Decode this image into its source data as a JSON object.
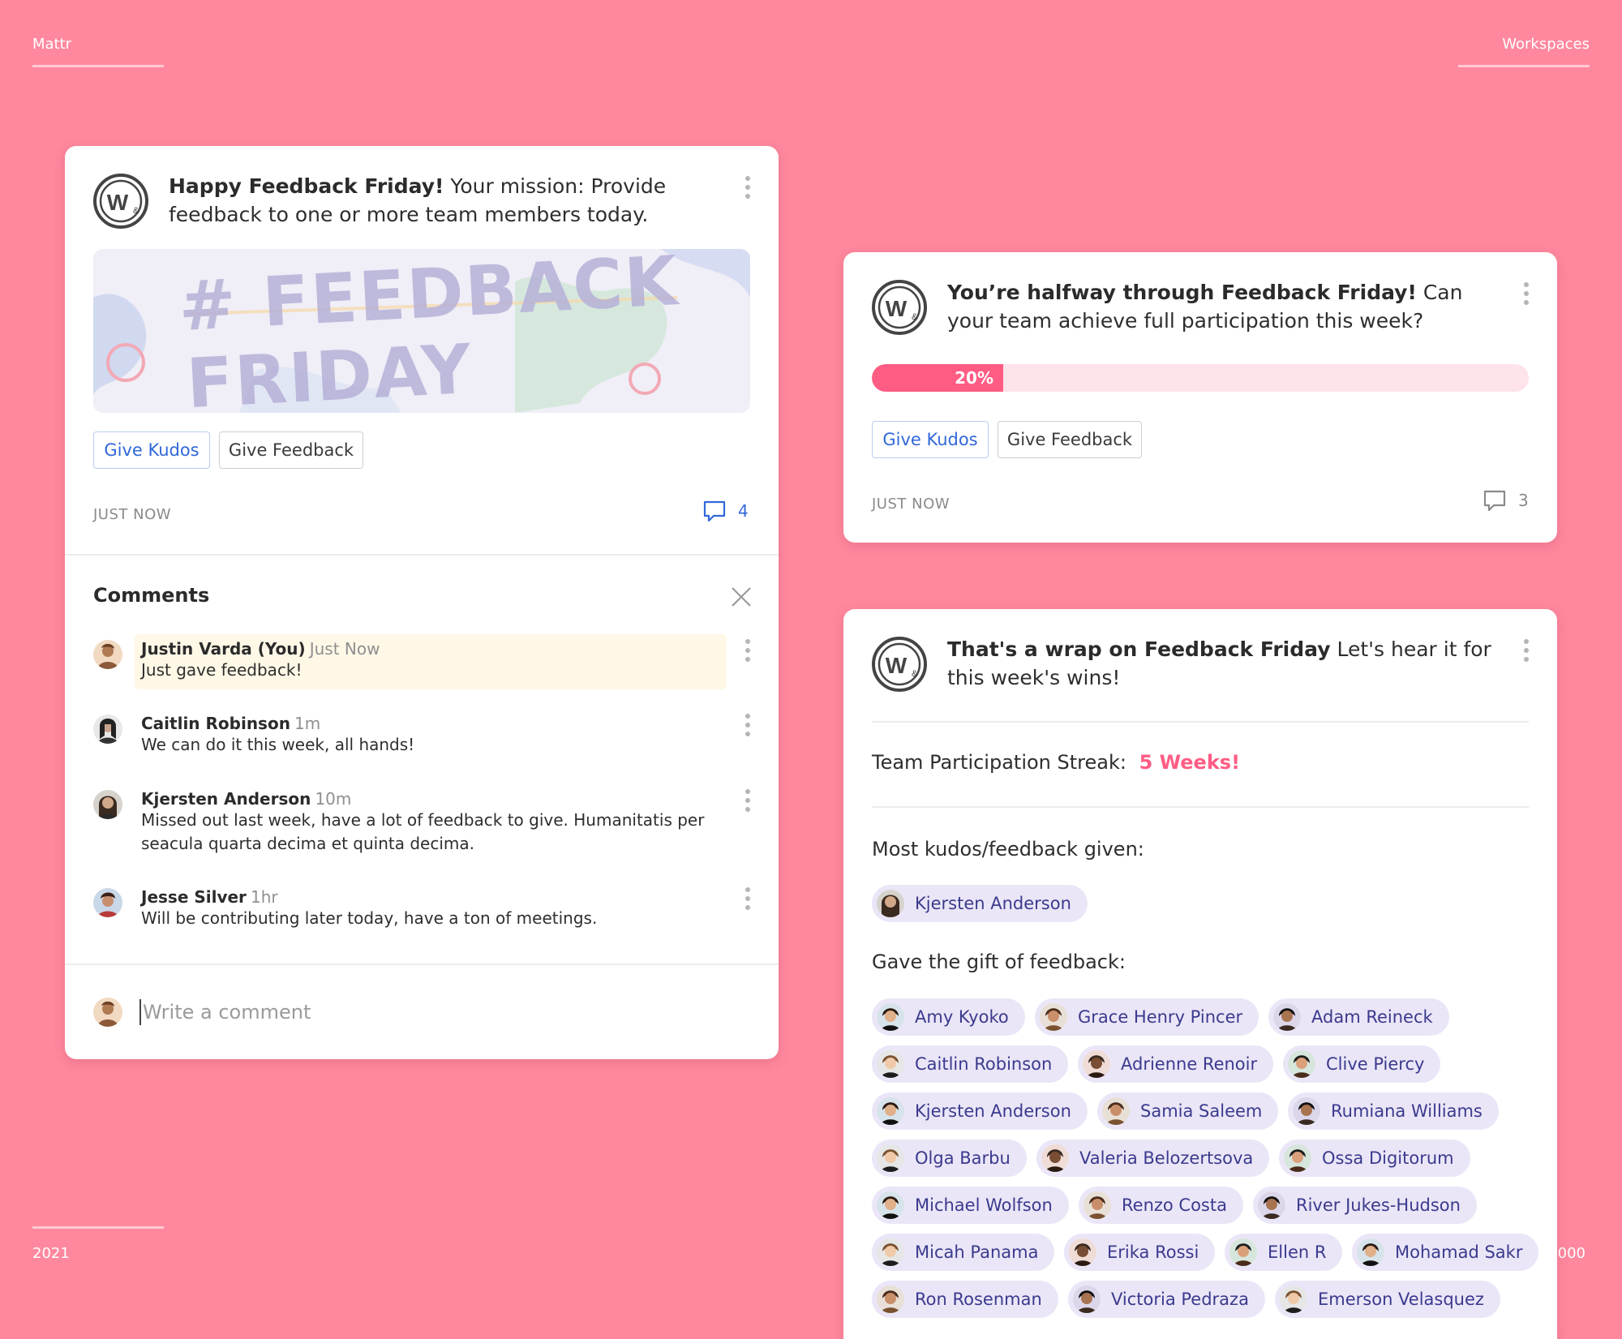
{
  "corners": {
    "top_left": "Mattr",
    "top_right": "Workspaces",
    "bottom_left": "2021",
    "bottom_right": "000"
  },
  "colors": {
    "background": "#FF889E",
    "accent_pink": "#FF5C84",
    "link_blue": "#3168d9",
    "pill_bg": "#EAE6F7",
    "pill_text": "#3b3a8e",
    "highlight": "#FFF8E7"
  },
  "card1": {
    "headline_bold": "Happy Feedback Friday!",
    "headline_rest": " Your mission: Provide feedback to one or more team members today.",
    "banner_line1": "# FEEDBACK",
    "banner_line2": "FRIDAY",
    "kudos_label": "Give Kudos",
    "feedback_label": "Give Feedback",
    "timestamp": "JUST NOW",
    "comment_count": "4",
    "comments_title": "Comments",
    "comments": [
      {
        "name": "Justin Varda (You)",
        "time": "Just Now",
        "text": "Just gave feedback!"
      },
      {
        "name": "Caitlin Robinson",
        "time": "1m",
        "text": "We can do it this week, all hands!"
      },
      {
        "name": "Kjersten Anderson",
        "time": "10m",
        "text": "Missed out last week, have a lot of feedback to give. Humanitatis per seacula quarta decima et quinta decima."
      },
      {
        "name": "Jesse Silver",
        "time": "1hr",
        "text": "Will be contributing later today, have a ton of meetings."
      }
    ],
    "comment_placeholder": "Write a comment"
  },
  "card2": {
    "headline_bold": "You’re halfway through Feedback Friday!",
    "headline_rest": " Can your team achieve full participation this week?",
    "progress_label": "20%",
    "progress_value": 0.2,
    "kudos_label": "Give Kudos",
    "feedback_label": "Give Feedback",
    "timestamp": "JUST NOW",
    "comment_count": "3"
  },
  "card3": {
    "headline_bold": "That's a wrap on Feedback Friday",
    "headline_rest": " Let's hear it for this week's wins!",
    "streak_label": "Team Participation Streak:",
    "streak_value": "5 Weeks!",
    "most_label": "Most kudos/feedback given:",
    "most_person": "Kjersten Anderson",
    "gift_label": "Gave the gift of feedback:",
    "people": [
      "Amy Kyoko",
      "Grace Henry Pincer",
      "Adam Reineck",
      "Caitlin Robinson",
      "Adrienne Renoir",
      "Clive Piercy",
      "Kjersten Anderson",
      "Samia Saleem",
      "Rumiana Williams",
      "Olga Barbu",
      "Valeria Belozertsova",
      "Ossa Digitorum",
      "Michael Wolfson",
      "Renzo Costa",
      "River Jukes-Hudson",
      "Micah Panama",
      "Erika Rossi",
      "Ellen R",
      "Mohamad Sakr",
      "Ron Rosenman",
      "Victoria Pedraza",
      "Emerson Velasquez"
    ]
  }
}
